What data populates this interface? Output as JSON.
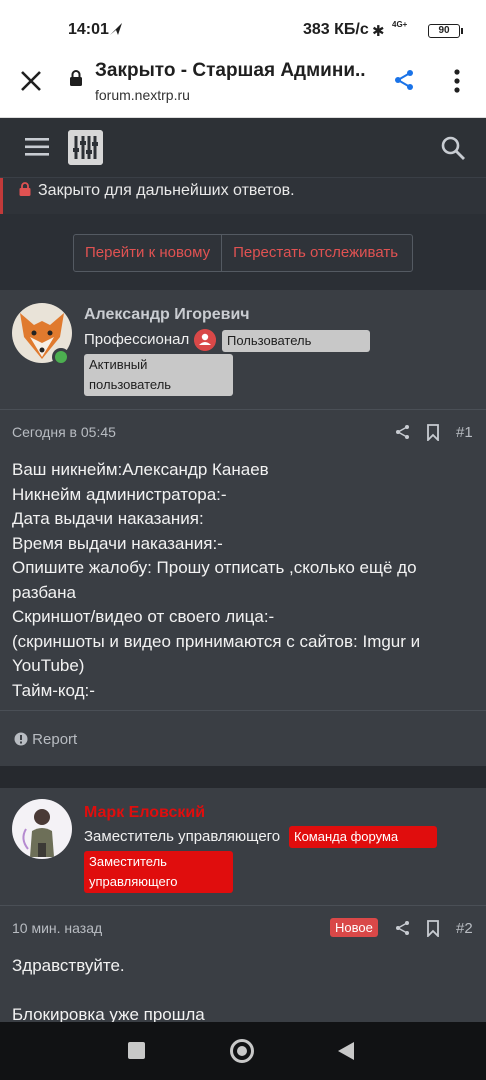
{
  "status_bar": {
    "time": "14:01",
    "speed": "383 КБ/с",
    "network": "4G+",
    "battery": "90"
  },
  "browser": {
    "title": "Закрыто - Старшая Админи...",
    "url": "forum.nextrp.ru"
  },
  "thread": {
    "locked_text": "Закрыто для дальнейших ответов.",
    "btn_new": "Перейти к новому",
    "btn_unwatch": "Перестать отслеживать"
  },
  "posts": [
    {
      "username": "Александр Игоревич",
      "username_color": "#c9ccd1",
      "user_title": "Професcионал",
      "banners": [
        "Пользователь",
        "Активный пользователь"
      ],
      "date": "Сегодня в 05:45",
      "number": "#1",
      "body": [
        "Ваш никнейм:Александр Канаев",
        "Никнейм администратора:-",
        "Дата выдачи наказания:",
        "Время выдачи наказания:-",
        "Опишите жалобу: Прошу отписать ,сколько ещё до разбана",
        "Скриншот/видео от своего лица:-",
        "(скриншоты и видео принимаются с сайтов: Imgur и YouTube)",
        "Тайм-код:-"
      ],
      "report": "Report"
    },
    {
      "username": "Марк Еловский",
      "username_color": "#e00d0d",
      "user_title": "Заместитель управляющего",
      "banners": [
        "Команда форума",
        "Заместитель управляющего"
      ],
      "date": "10 мин. назад",
      "new_badge": "Новое",
      "number": "#2",
      "body": [
        "Здравствуйте.",
        "",
        "Блокировка уже прошла"
      ]
    }
  ],
  "colors": {
    "accent_red": "#e05252",
    "online_green": "#4caf50",
    "link_blue": "#1a73e8"
  }
}
